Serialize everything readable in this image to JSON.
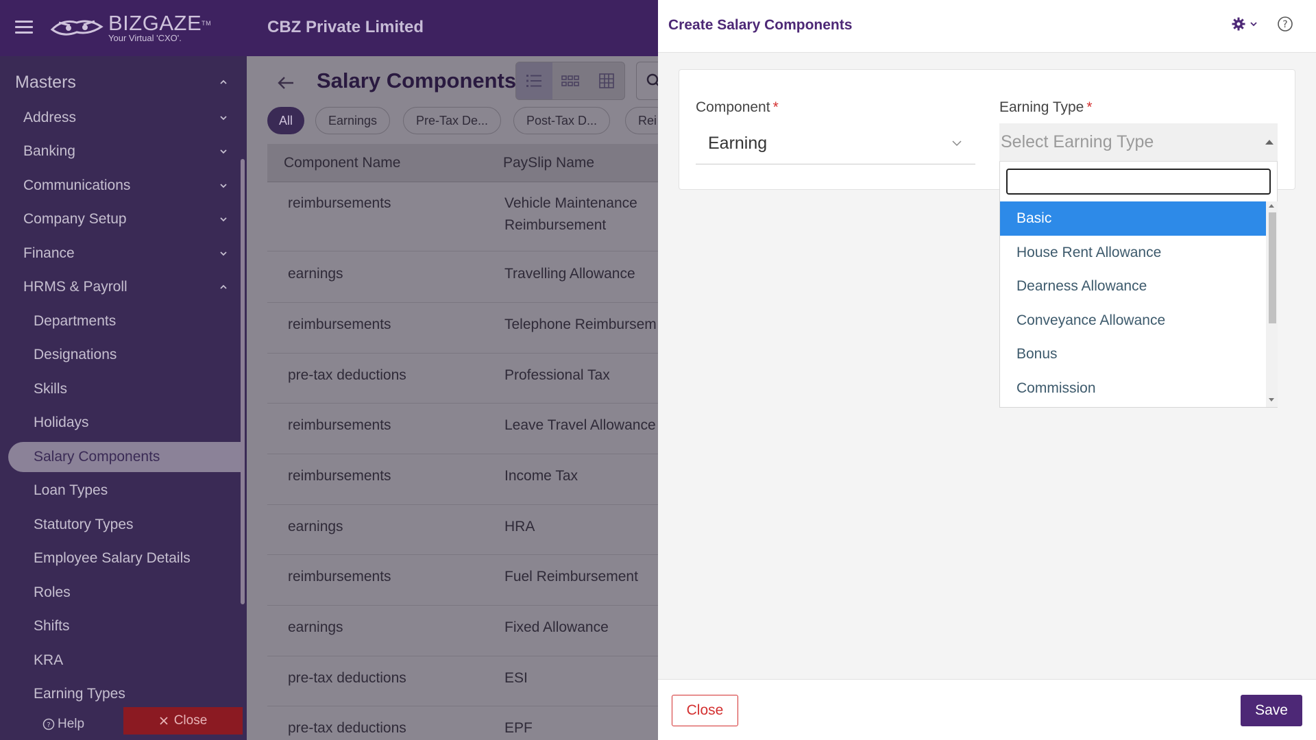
{
  "header": {
    "logo_text": "BIZGAZE",
    "logo_tagline": "Your Virtual 'CXO'.",
    "logo_tm": "TM",
    "company": "CBZ Private Limited"
  },
  "sidebar": {
    "section_title": "Masters",
    "groups": [
      {
        "label": "Address"
      },
      {
        "label": "Banking"
      },
      {
        "label": "Communications"
      },
      {
        "label": "Company Setup"
      },
      {
        "label": "Finance"
      },
      {
        "label": "HRMS & Payroll"
      }
    ],
    "sub_items": [
      {
        "label": "Departments"
      },
      {
        "label": "Designations"
      },
      {
        "label": "Skills"
      },
      {
        "label": "Holidays"
      },
      {
        "label": "Salary Components"
      },
      {
        "label": "Loan Types"
      },
      {
        "label": "Statutory Types"
      },
      {
        "label": "Employee Salary Details"
      },
      {
        "label": "Roles"
      },
      {
        "label": "Shifts"
      },
      {
        "label": "KRA"
      },
      {
        "label": "Earning Types"
      }
    ],
    "help_label": "Help",
    "close_label": "Close"
  },
  "main": {
    "title": "Salary Components",
    "chips": [
      {
        "label": "All"
      },
      {
        "label": "Earnings"
      },
      {
        "label": "Pre-Tax De..."
      },
      {
        "label": "Post-Tax D..."
      },
      {
        "label": "Rei"
      }
    ],
    "columns": [
      "Component Name",
      "PaySlip Name"
    ],
    "rows": [
      {
        "component": "reimbursements",
        "payslip_line1": "Vehicle Maintenance",
        "payslip_line2": "Reimbursement"
      },
      {
        "component": "earnings",
        "payslip_line1": "Travelling Allowance"
      },
      {
        "component": "reimbursements",
        "payslip_line1": "Telephone Reimbursem"
      },
      {
        "component": "pre-tax deductions",
        "payslip_line1": "Professional Tax"
      },
      {
        "component": "reimbursements",
        "payslip_line1": "Leave Travel Allowance"
      },
      {
        "component": "reimbursements",
        "payslip_line1": "Income Tax"
      },
      {
        "component": "earnings",
        "payslip_line1": "HRA"
      },
      {
        "component": "reimbursements",
        "payslip_line1": "Fuel Reimbursement"
      },
      {
        "component": "earnings",
        "payslip_line1": "Fixed Allowance"
      },
      {
        "component": "pre-tax deductions",
        "payslip_line1": "ESI"
      },
      {
        "component": "pre-tax deductions",
        "payslip_line1": "EPF"
      }
    ]
  },
  "drawer": {
    "title": "Create Salary Components",
    "component_label": "Component",
    "component_value": "Earning",
    "earning_type_label": "Earning Type",
    "required_mark": "*",
    "earning_type_placeholder": "Select Earning Type",
    "search_value": "",
    "options": [
      {
        "label": "Basic"
      },
      {
        "label": "House Rent Allowance"
      },
      {
        "label": "Dearness Allowance"
      },
      {
        "label": "Conveyance Allowance"
      },
      {
        "label": "Bonus"
      },
      {
        "label": "Commission"
      }
    ],
    "highlighted_option": "Basic",
    "close_label": "Close",
    "save_label": "Save"
  },
  "colors": {
    "header_bg": "#3e2260",
    "accent_purple": "#4d2876",
    "highlight_blue": "#2d8ae8",
    "required_red": "#d32f2f"
  },
  "icons": [
    "menu-icon",
    "bizgaze-logo-icon",
    "chevron-up-icon",
    "chevron-down-icon",
    "back-arrow-icon",
    "list-view-icon",
    "card-view-icon",
    "grid-view-icon",
    "search-icon",
    "gear-icon",
    "help-circle-icon",
    "close-x-icon"
  ]
}
